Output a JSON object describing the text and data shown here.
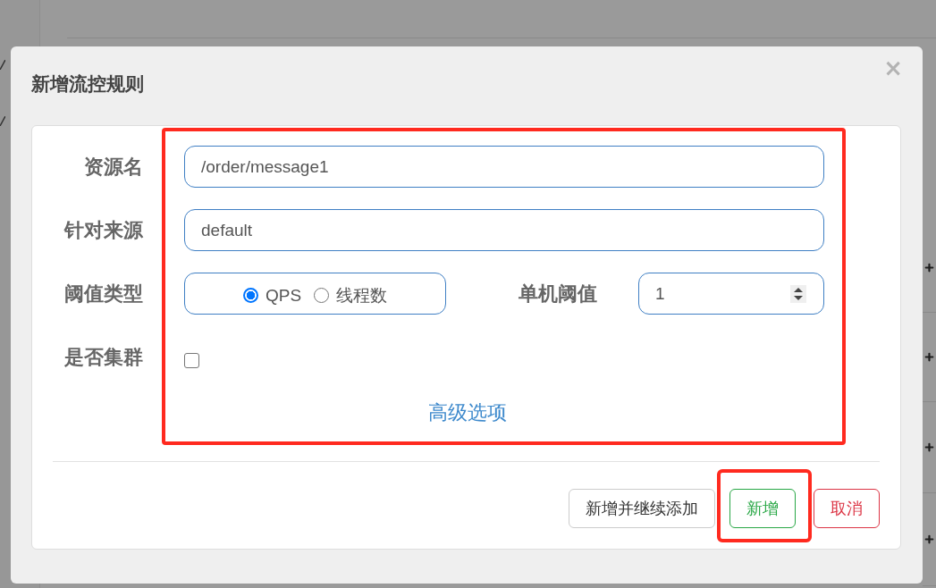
{
  "dialog": {
    "title": "新增流控规则",
    "close": "×",
    "form": {
      "highlighted": true,
      "fields": [
        {
          "kind": "text",
          "label": "资源名",
          "value": "/order/message1"
        },
        {
          "kind": "text",
          "label": "针对来源",
          "value": "default"
        },
        {
          "kind": "threshold",
          "label": "阈值类型",
          "options": [
            {
              "label": "QPS",
              "selected": true
            },
            {
              "label": "线程数",
              "selected": false
            }
          ],
          "count_label": "单机阈值",
          "count_value": "1"
        },
        {
          "kind": "checkbox",
          "label": "是否集群",
          "checked": false
        }
      ],
      "advanced_link": "高级选项"
    },
    "buttons": [
      {
        "label": "新增并继续添加",
        "kind": "default",
        "highlighted": false
      },
      {
        "label": "新增",
        "kind": "success",
        "highlighted": true
      },
      {
        "label": "取消",
        "kind": "danger",
        "highlighted": false
      }
    ]
  }
}
